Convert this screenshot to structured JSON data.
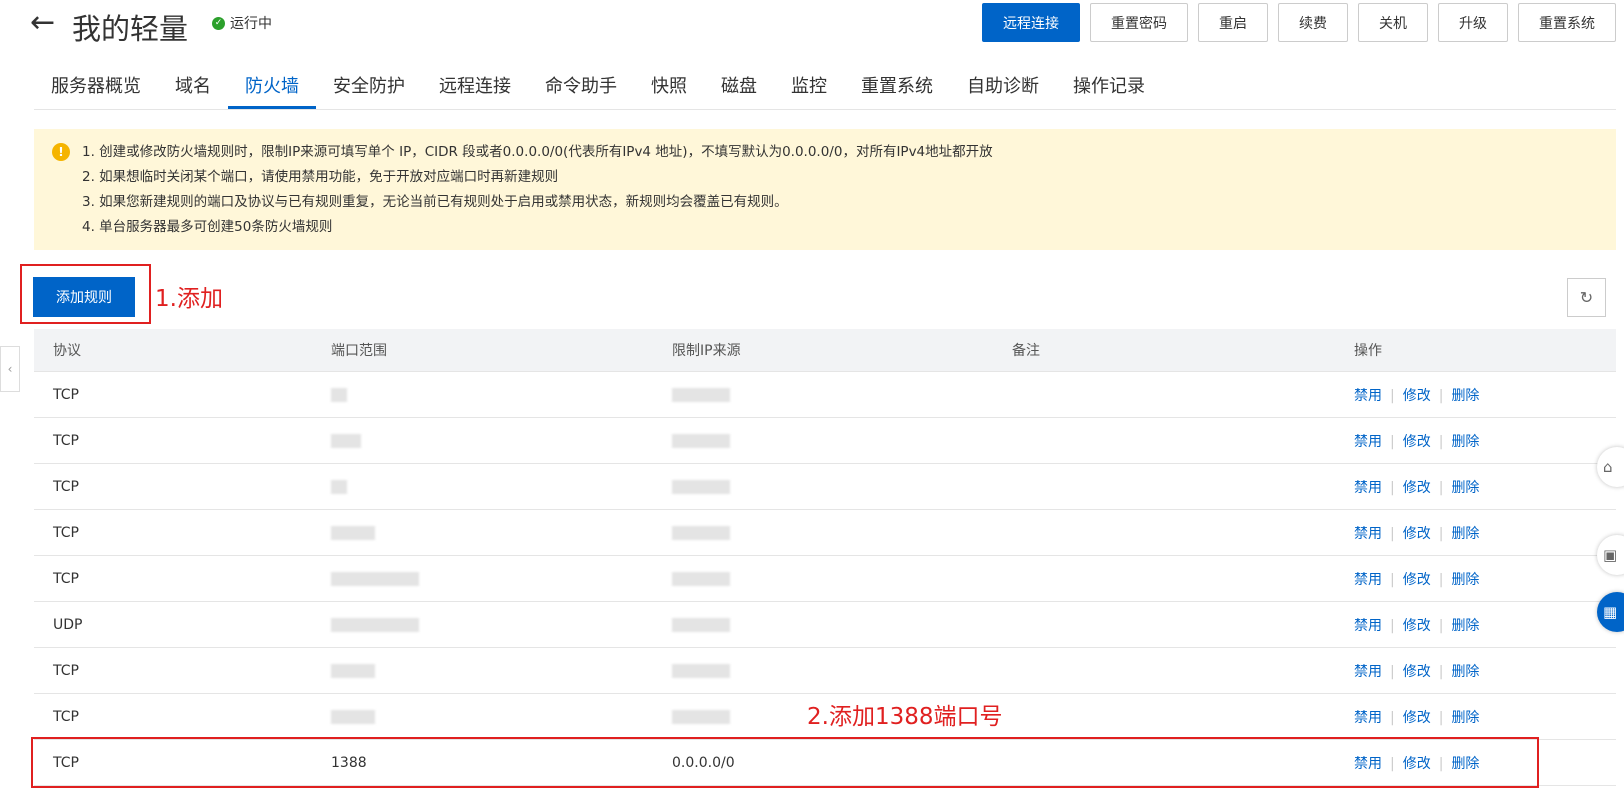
{
  "header": {
    "back_icon": "←",
    "title": "我的轻量",
    "status": "运行中",
    "actions": [
      "远程连接",
      "重置密码",
      "重启",
      "续费",
      "关机",
      "升级",
      "重置系统"
    ]
  },
  "tabs": [
    "服务器概览",
    "域名",
    "防火墙",
    "安全防护",
    "远程连接",
    "命令助手",
    "快照",
    "磁盘",
    "监控",
    "重置系统",
    "自助诊断",
    "操作记录"
  ],
  "active_tab": "防火墙",
  "notice": [
    "1. 创建或修改防火墙规则时，限制IP来源可填写单个 IP，CIDR 段或者0.0.0.0/0(代表所有IPv4 地址)，不填写默认为0.0.0.0/0，对所有IPv4地址都开放",
    "2. 如果想临时关闭某个端口，请使用禁用功能，免于开放对应端口时再新建规则",
    "3. 如果您新建规则的端口及协议与已有规则重复，无论当前已有规则处于启用或禁用状态，新规则均会覆盖已有规则。",
    "4. 单台服务器最多可创建50条防火墙规则"
  ],
  "add_button": "添加规则",
  "annotation1": "1.添加",
  "annotation2": "2.添加1388端口号",
  "table": {
    "headers": [
      "协议",
      "端口范围",
      "限制IP来源",
      "备注",
      "操作"
    ],
    "ops": [
      "禁用",
      "修改",
      "删除"
    ],
    "rows": [
      {
        "protocol": "TCP",
        "port": "",
        "ip": ""
      },
      {
        "protocol": "TCP",
        "port": "",
        "ip": ""
      },
      {
        "protocol": "TCP",
        "port": "",
        "ip": ""
      },
      {
        "protocol": "TCP",
        "port": "",
        "ip": ""
      },
      {
        "protocol": "TCP",
        "port": "",
        "ip": ""
      },
      {
        "protocol": "UDP",
        "port": "",
        "ip": ""
      },
      {
        "protocol": "TCP",
        "port": "",
        "ip": ""
      },
      {
        "protocol": "TCP",
        "port": "",
        "ip": ""
      },
      {
        "protocol": "TCP",
        "port": "1388",
        "ip": "0.0.0.0/0"
      }
    ]
  },
  "colors": {
    "primary": "#0064c8",
    "annotation": "#e02020",
    "notice_bg": "#fff7d9",
    "status_ok": "#2ca02c"
  }
}
